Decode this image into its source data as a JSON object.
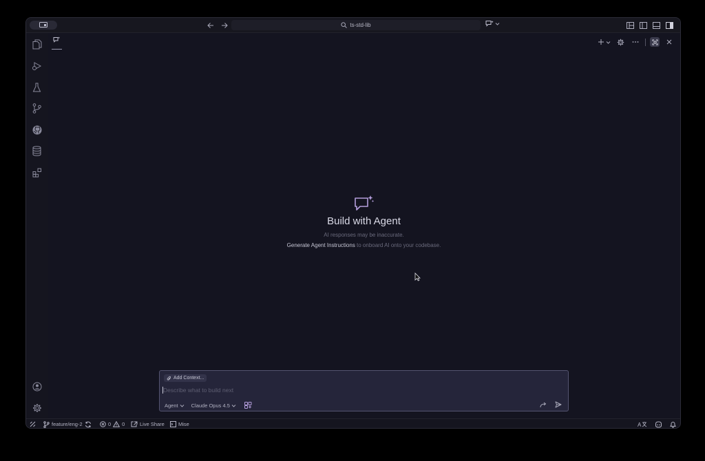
{
  "titlebar": {
    "search_text": "ts-std-lib"
  },
  "chat": {
    "welcome_title": "Build with Agent",
    "disclaimer": "AI responses may be inaccurate.",
    "instructions_link": "Generate Agent Instructions",
    "instructions_suffix": " to onboard AI onto your codebase."
  },
  "input": {
    "add_context_label": "Add Context...",
    "placeholder": "Describe what to build next",
    "mode_label": "Agent",
    "model_label": "Claude Opus 4.5"
  },
  "statusbar": {
    "branch": "feature/eng-2",
    "errors": "0",
    "warnings": "0",
    "live_share": "Live Share",
    "mise": "Mise"
  },
  "colors": {
    "accent": "#b39ddb",
    "background": "#141420",
    "input_border": "#545470"
  }
}
